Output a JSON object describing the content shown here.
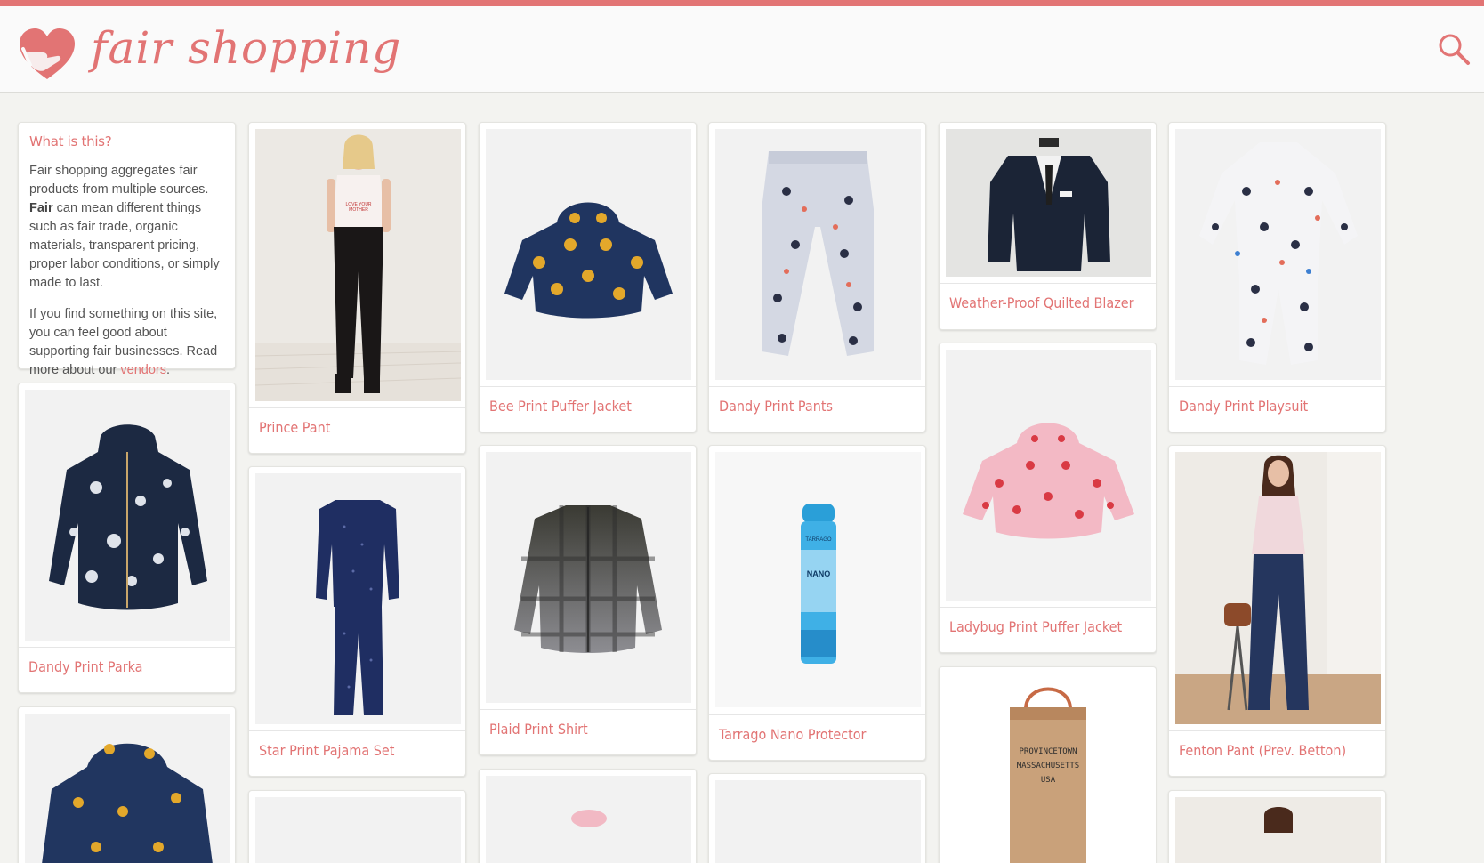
{
  "site": {
    "name": "fair shopping",
    "accent": "#e27474"
  },
  "info": {
    "title": "What is this?",
    "p1_start": "Fair shopping aggregates fair products from multiple sources.",
    "p1_bold": "Fair",
    "p1_end": "can mean different things such as fair trade, organic materials, transparent pricing, proper labor conditions, or simply made to last.",
    "p2_start": "If you find something on this site, you can feel good about supporting fair businesses. Read more about our",
    "p2_link": "vendors",
    "p2_end": "."
  },
  "products": [
    {
      "name": "Dandy Print Parka",
      "icon": "parka-image"
    },
    {
      "name": "Prince Pant",
      "icon": "model-pants-image"
    },
    {
      "name": "Star Print Pajama Set",
      "icon": "pajama-image"
    },
    {
      "name": "Bee Print Puffer Jacket",
      "icon": "puffer-jacket-image"
    },
    {
      "name": "Plaid Print Shirt",
      "icon": "plaid-shirt-image"
    },
    {
      "name": "Dandy Print Pants",
      "icon": "print-pants-image"
    },
    {
      "name": "Tarrago Nano Protector",
      "icon": "spray-can-image"
    },
    {
      "name": "Weather-Proof Quilted Blazer",
      "icon": "blazer-image"
    },
    {
      "name": "Ladybug Print Puffer Jacket",
      "icon": "pink-puffer-image"
    },
    {
      "name": "Dandy Print Playsuit",
      "icon": "playsuit-image"
    },
    {
      "name": "Fenton Pant (Prev. Betton)",
      "icon": "model-jeans-image"
    }
  ],
  "tote_text": [
    "PROVINCETOWN",
    "MASSACHUSETTS",
    "USA"
  ]
}
